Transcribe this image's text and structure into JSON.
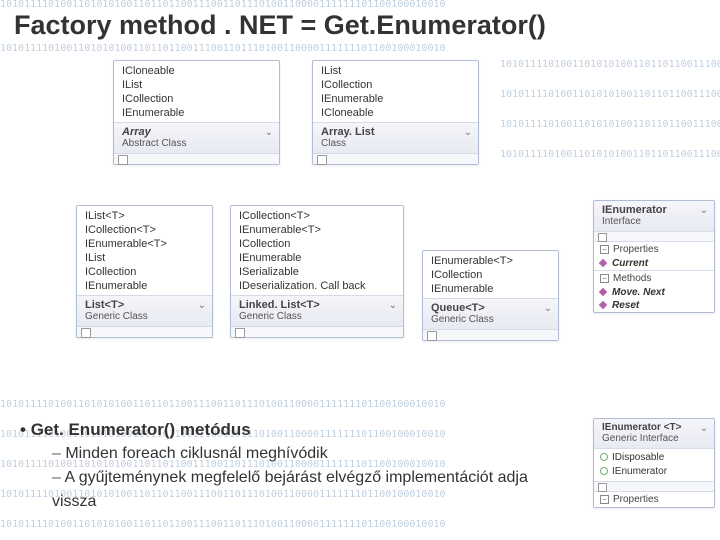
{
  "title": "Factory method . NET  =  Get.Enumerator()",
  "binrow": "10101111010011010101001101101100111001101110100110000111111101100100010010",
  "classes": {
    "array": {
      "name": "Array",
      "kind": "Abstract Class",
      "ifaces": [
        "ICloneable",
        "IList",
        "ICollection",
        "IEnumerable"
      ]
    },
    "arraylist": {
      "name": "Array. List",
      "kind": "Class",
      "ifaces": [
        "IList",
        "ICollection",
        "IEnumerable",
        "ICloneable"
      ]
    },
    "listt": {
      "name": "List<T>",
      "kind": "Generic Class",
      "ifaces": [
        "IList<T>",
        "ICollection<T>",
        "IEnumerable<T>",
        "IList",
        "ICollection",
        "IEnumerable"
      ]
    },
    "linkedlistt": {
      "name": "Linked. List<T>",
      "kind": "Generic Class",
      "ifaces": [
        "ICollection<T>",
        "IEnumerable<T>",
        "ICollection",
        "IEnumerable",
        "ISerializable",
        "IDeserialization. Call back"
      ]
    },
    "queuet": {
      "name": "Queue<T>",
      "kind": "Generic Class",
      "ifaces": [
        "IEnumerable<T>",
        "ICollection",
        "IEnumerable"
      ]
    }
  },
  "ienum": {
    "name": "IEnumerator",
    "kind": "Interface",
    "sec1": "Properties",
    "p1": "Current",
    "sec2": "Methods",
    "m1": "Move. Next",
    "m2": "Reset"
  },
  "ienumt": {
    "name": "IEnumerator <T>",
    "kind": "Generic Interface",
    "i1": "IDisposable",
    "i2": "IEnumerator",
    "sec1": "Properties"
  },
  "bullets": {
    "b1": "Get. Enumerator() metódus",
    "b2": "Minden foreach ciklusnál meghívódik",
    "b3": "A gyűjteménynek megfelelő bejárást elvégző implementációt adja vissza"
  }
}
